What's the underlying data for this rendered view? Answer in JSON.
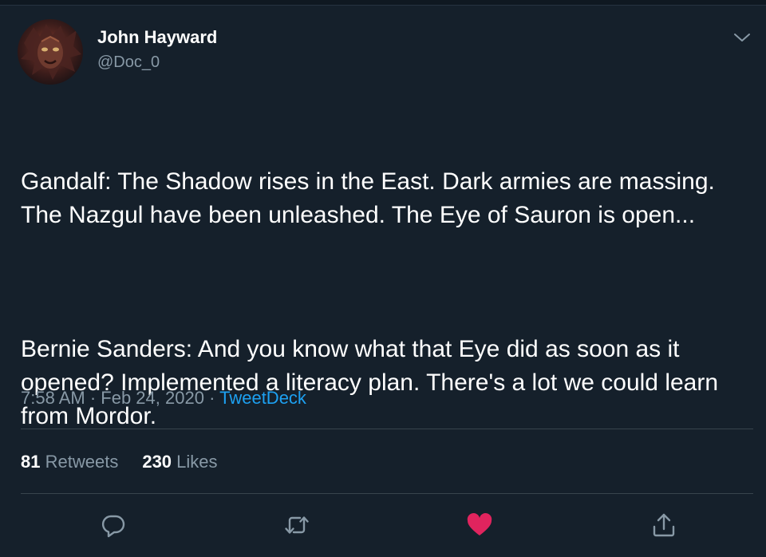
{
  "author": {
    "name": "John Hayward",
    "handle": "@Doc_0"
  },
  "tweet": {
    "paragraphs": [
      "Gandalf: The Shadow rises in the East. Dark armies are massing. The Nazgul have been unleashed. The Eye of Sauron is open...",
      "Bernie Sanders: And you know what that Eye did as soon as it opened? Implemented a literacy plan. There's a lot we could learn from Mordor."
    ]
  },
  "meta": {
    "time": "7:58 AM",
    "separator1": " · ",
    "date": "Feb 24, 2020",
    "separator2": " · ",
    "source": "TweetDeck"
  },
  "stats": {
    "retweets_count": "81",
    "retweets_label": "Retweets",
    "likes_count": "230",
    "likes_label": "Likes"
  },
  "icons": {
    "menu": "chevron-down-icon",
    "reply": "reply-icon",
    "retweet": "retweet-icon",
    "like": "heart-icon",
    "share": "share-icon"
  },
  "colors": {
    "background": "#15202b",
    "text_secondary": "#8899a6",
    "link": "#1da1f2",
    "like_active": "#e0245e",
    "divider": "#38444d"
  }
}
